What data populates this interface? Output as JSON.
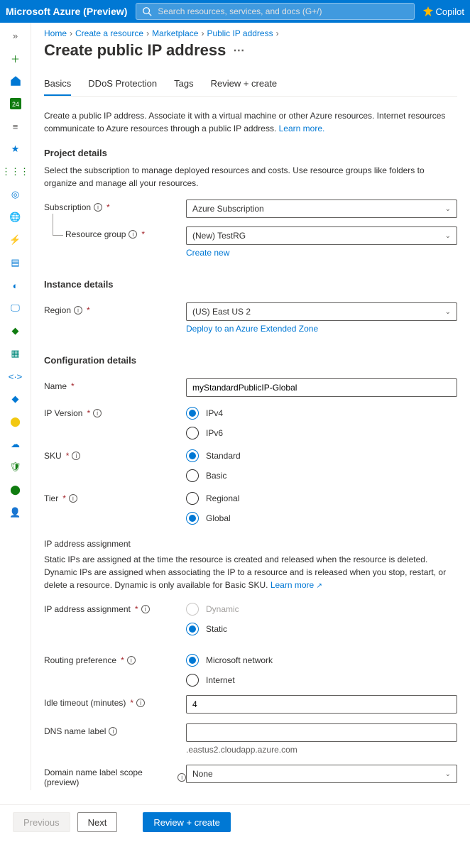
{
  "topbar": {
    "title": "Microsoft Azure (Preview)",
    "search_placeholder": "Search resources, services, and docs (G+/)",
    "copilot": "Copilot"
  },
  "breadcrumb": [
    "Home",
    "Create a resource",
    "Marketplace",
    "Public IP address"
  ],
  "page_title": "Create public IP address",
  "tabs": [
    "Basics",
    "DDoS Protection",
    "Tags",
    "Review + create"
  ],
  "intro": {
    "text": "Create a public IP address. Associate it with a virtual machine or other Azure resources. Internet resources communicate to Azure resources through a public IP address. ",
    "learn_more": "Learn more."
  },
  "project": {
    "heading": "Project details",
    "sub": "Select the subscription to manage deployed resources and costs. Use resource groups like folders to organize and manage all your resources.",
    "subscription_label": "Subscription",
    "subscription_value": "Azure Subscription",
    "resource_group_label": "Resource group",
    "resource_group_value": "(New) TestRG",
    "create_new": "Create new"
  },
  "instance": {
    "heading": "Instance details",
    "region_label": "Region",
    "region_value": "(US) East US 2",
    "extended_zone": "Deploy to an Azure Extended Zone"
  },
  "config": {
    "heading": "Configuration details",
    "name_label": "Name",
    "name_value": "myStandardPublicIP-Global",
    "ip_version_label": "IP Version",
    "ip_version_options": [
      "IPv4",
      "IPv6"
    ],
    "ip_version_selected": "IPv4",
    "sku_label": "SKU",
    "sku_options": [
      "Standard",
      "Basic"
    ],
    "sku_selected": "Standard",
    "tier_label": "Tier",
    "tier_options": [
      "Regional",
      "Global"
    ],
    "tier_selected": "Global",
    "assignment_head": "IP address assignment",
    "assignment_help": "Static IPs are assigned at the time the resource is created and released when the resource is deleted. Dynamic IPs are assigned when associating the IP to a resource and is released when you stop, restart, or delete a resource. Dynamic is only available for Basic SKU. ",
    "assignment_learn_more": "Learn more",
    "assignment_label": "IP address assignment",
    "assignment_options": [
      "Dynamic",
      "Static"
    ],
    "assignment_selected": "Static",
    "routing_label": "Routing preference",
    "routing_options": [
      "Microsoft network",
      "Internet"
    ],
    "routing_selected": "Microsoft network",
    "idle_label": "Idle timeout (minutes)",
    "idle_value": "4",
    "dns_label": "DNS name label",
    "dns_value": "",
    "dns_suffix": ".eastus2.cloudapp.azure.com",
    "domain_scope_label": "Domain name label scope (preview)",
    "domain_scope_value": "None"
  },
  "footer": {
    "previous": "Previous",
    "next": "Next",
    "review": "Review + create"
  },
  "rail_icons": [
    "expand-icon",
    "add-icon",
    "home-icon",
    "dashboard-icon",
    "list-icon",
    "star-icon",
    "apps-icon",
    "target-icon",
    "globe-icon",
    "functions-icon",
    "sql-icon",
    "database-icon",
    "monitor-icon",
    "advisor-icon",
    "notebook-icon",
    "code-icon",
    "docs-icon",
    "alert-icon",
    "devops-icon",
    "security-icon",
    "defender-icon",
    "user-icon"
  ]
}
